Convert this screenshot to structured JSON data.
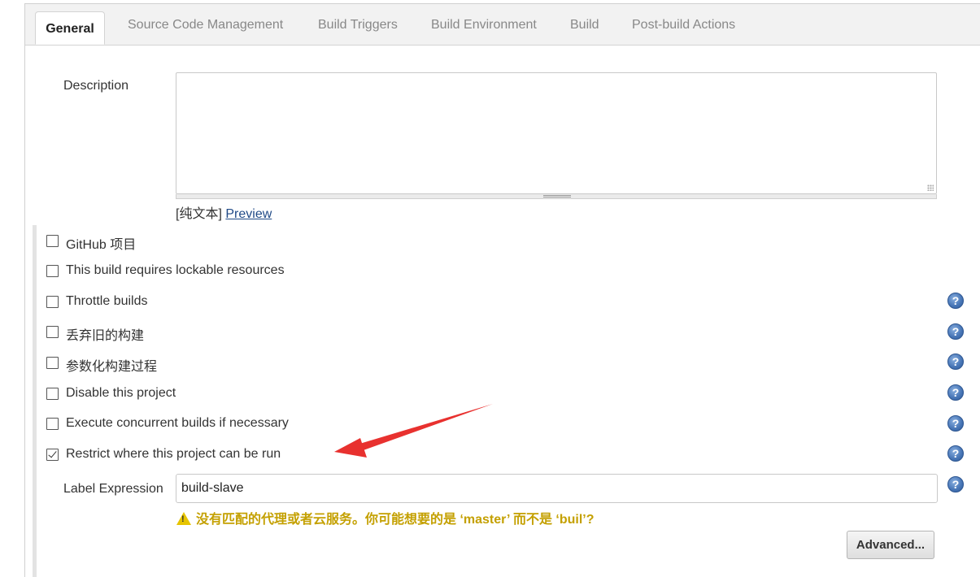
{
  "tabs": [
    {
      "label": "General",
      "active": true
    },
    {
      "label": "Source Code Management"
    },
    {
      "label": "Build Triggers"
    },
    {
      "label": "Build Environment"
    },
    {
      "label": "Build"
    },
    {
      "label": "Post-build Actions"
    }
  ],
  "description": {
    "label": "Description",
    "value": "",
    "format_prefix": "[纯文本]",
    "preview_link": "Preview"
  },
  "options": [
    {
      "label": "GitHub 项目",
      "checked": false,
      "help": false
    },
    {
      "label": "This build requires lockable resources",
      "checked": false,
      "help": false
    },
    {
      "label": "Throttle builds",
      "checked": false,
      "help": true
    },
    {
      "label": "丢弃旧的构建",
      "checked": false,
      "help": true
    },
    {
      "label": "参数化构建过程",
      "checked": false,
      "help": true
    },
    {
      "label": "Disable this project",
      "checked": false,
      "help": true
    },
    {
      "label": "Execute concurrent builds if necessary",
      "checked": false,
      "help": true
    },
    {
      "label": "Restrict where this project can be run",
      "checked": true,
      "help": true
    }
  ],
  "label_expression": {
    "label": "Label Expression",
    "value": "build-slave",
    "warning": "没有匹配的代理或者云服务。你可能想要的是 ‘master’ 而不是 ‘buil’?"
  },
  "advanced_button": "Advanced...",
  "help_glyph": "?",
  "warning_glyph": "!",
  "colors": {
    "warning_text": "#c4a000",
    "link": "#204a87",
    "annotation_arrow": "#e8312f",
    "help_icon": "#4a78b8"
  }
}
